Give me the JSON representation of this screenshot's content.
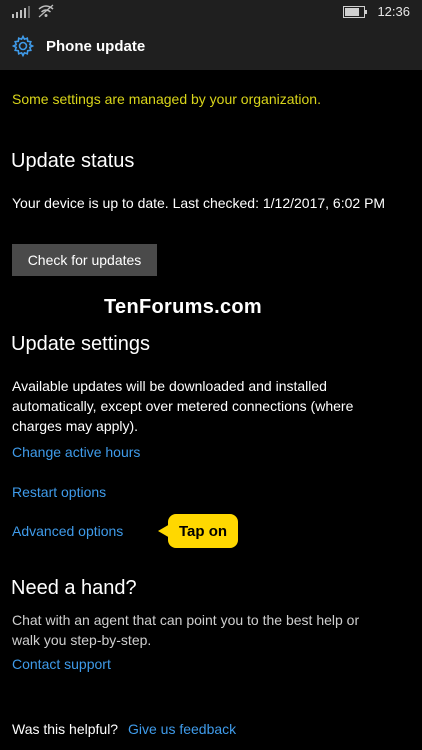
{
  "status_bar": {
    "time": "12:36"
  },
  "header": {
    "title": "Phone update",
    "icon": "gear-icon"
  },
  "notice": "Some settings are managed by your organization.",
  "update_status": {
    "heading": "Update status",
    "message": "Your device is up to date. Last checked: 1/12/2017, 6:02 PM",
    "check_button": "Check for updates"
  },
  "watermark": "TenForums.com",
  "update_settings": {
    "heading": "Update settings",
    "description_line1": "Available updates will be downloaded and installed",
    "description_line2": "automatically, except over metered connections (where",
    "description_line3": "charges may apply).",
    "links": {
      "change_active_hours": "Change active hours",
      "restart_options": "Restart options",
      "advanced_options": "Advanced options"
    },
    "callout": "Tap on"
  },
  "help": {
    "heading": "Need a hand?",
    "line1": "Chat with an agent that can point you to the best help or",
    "line2": "walk you step-by-step.",
    "contact_link": "Contact support"
  },
  "feedback": {
    "question": "Was this helpful?",
    "link": "Give us feedback"
  },
  "colors": {
    "accent_link": "#3f9bea",
    "notice": "#d9d51a",
    "callout": "#ffd800",
    "bar_bg": "#1f1f1f"
  }
}
